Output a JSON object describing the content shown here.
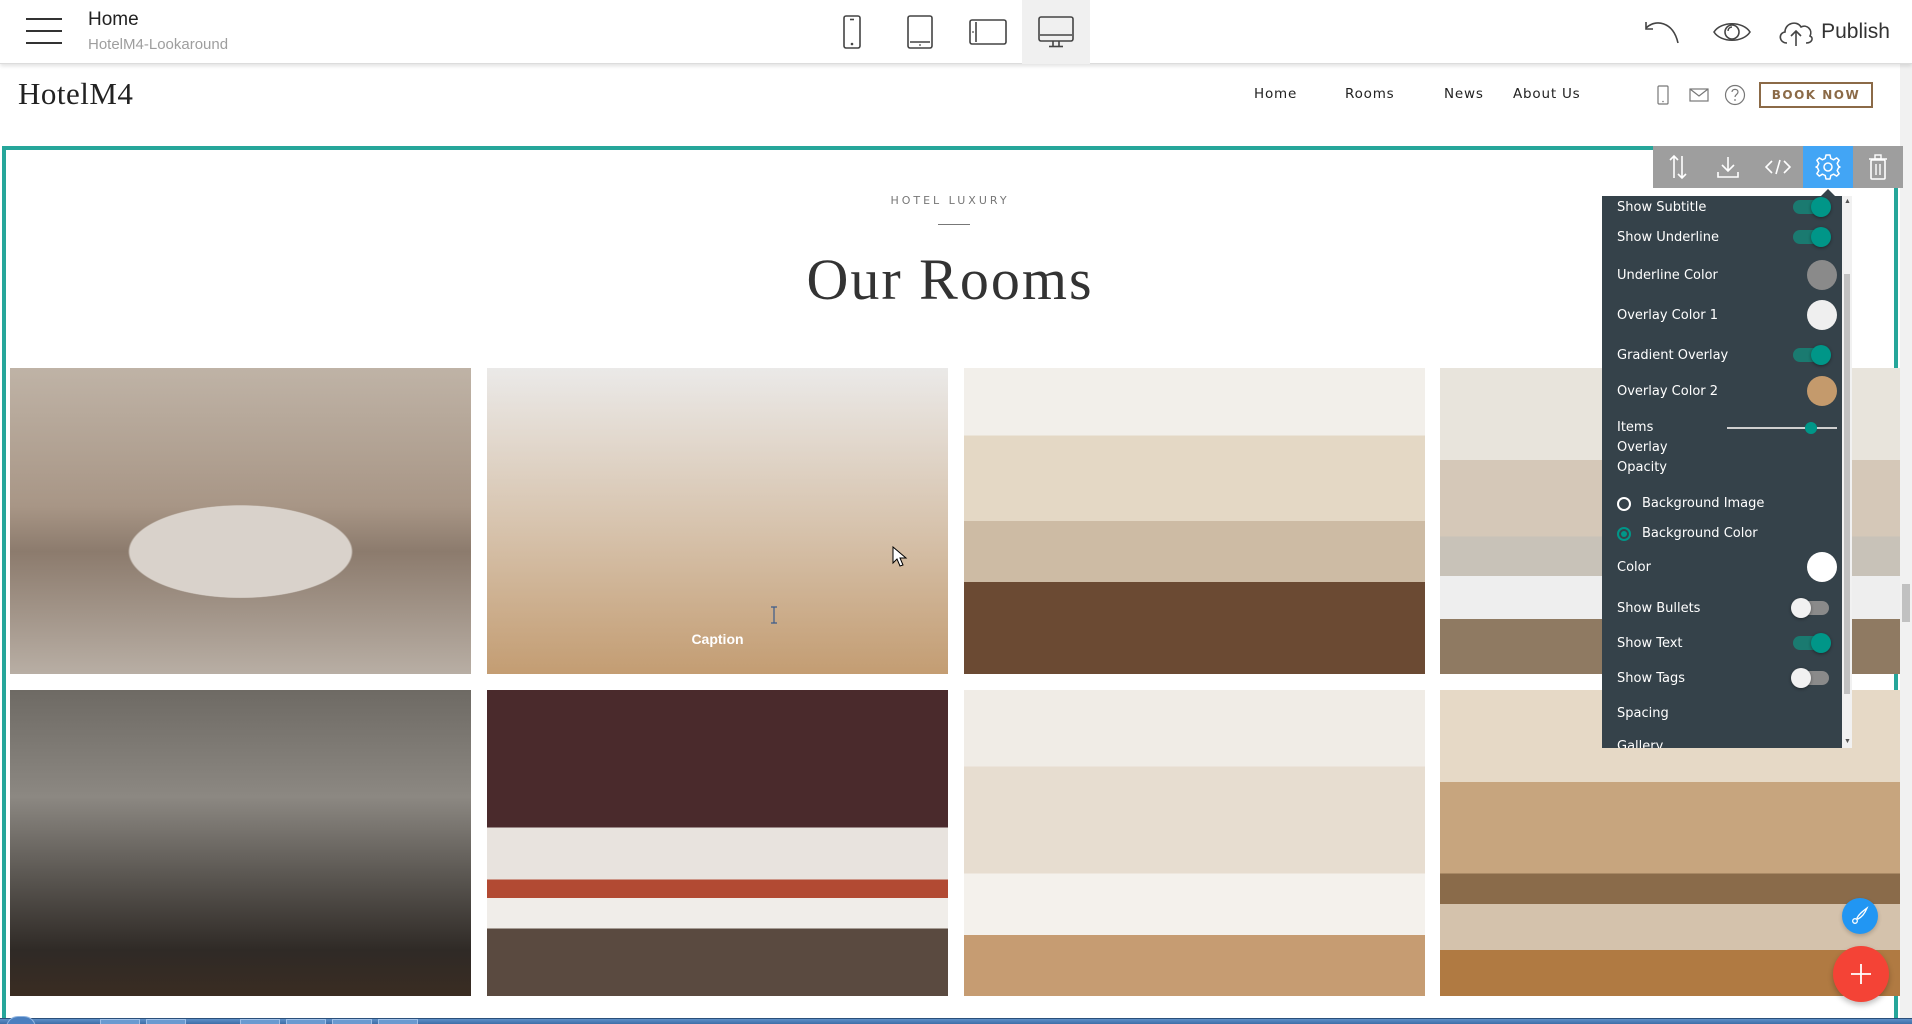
{
  "topbar": {
    "page_title": "Home",
    "project_name": "HotelM4-Lookaround",
    "devices": [
      "mobile",
      "tablet",
      "tablet-landscape",
      "desktop"
    ],
    "active_device": "desktop",
    "publish_label": "Publish"
  },
  "site": {
    "logo": "HotelM4",
    "nav": [
      "Home",
      "Rooms",
      "News",
      "About Us"
    ],
    "book_now": "BOOK NOW"
  },
  "section": {
    "subtitle": "HOTEL LUXURY",
    "title": "Our Rooms",
    "gallery": [
      {
        "id": 1,
        "caption": "",
        "hovered": false
      },
      {
        "id": 2,
        "caption": "Caption",
        "hovered": true
      },
      {
        "id": 3,
        "caption": "",
        "hovered": false
      },
      {
        "id": 4,
        "caption": "",
        "hovered": false
      },
      {
        "id": 5,
        "caption": "",
        "hovered": false
      },
      {
        "id": 6,
        "caption": "",
        "hovered": false
      },
      {
        "id": 7,
        "caption": "",
        "hovered": false
      },
      {
        "id": 8,
        "caption": "",
        "hovered": false
      }
    ]
  },
  "block_toolbar": {
    "tools": [
      "move",
      "save",
      "code",
      "settings",
      "delete"
    ],
    "active": "settings"
  },
  "settings_panel": {
    "show_subtitle": {
      "label": "Show Subtitle",
      "on": true
    },
    "show_underline": {
      "label": "Show Underline",
      "on": true
    },
    "underline_color": {
      "label": "Underline Color",
      "color": "#8a8a8a"
    },
    "overlay_color_1": {
      "label": "Overlay Color 1",
      "color": "#efefef"
    },
    "gradient_overlay": {
      "label": "Gradient Overlay",
      "on": true
    },
    "overlay_color_2": {
      "label": "Overlay Color 2",
      "color": "#c49a6c"
    },
    "items_overlay_opacity": {
      "label_lines": [
        "Items",
        "Overlay",
        "Opacity"
      ],
      "value_fraction": 0.76
    },
    "background_image": {
      "label": "Background Image",
      "checked": false
    },
    "background_color": {
      "label": "Background Color",
      "checked": true
    },
    "color": {
      "label": "Color",
      "color": "#ffffff"
    },
    "show_bullets": {
      "label": "Show Bullets",
      "on": false
    },
    "show_text": {
      "label": "Show Text",
      "on": true
    },
    "show_tags": {
      "label": "Show Tags",
      "on": false
    },
    "spacing": {
      "label": "Spacing"
    },
    "gallery": {
      "label": "Gallery"
    }
  },
  "colors": {
    "accent_teal": "#26a69a",
    "toggle_on": "#009688",
    "panel_bg": "#35424a",
    "active_tool": "#42a5f5",
    "fab_add": "#f44336",
    "fab_style": "#2196f3",
    "book_now": "#8b6a47"
  }
}
